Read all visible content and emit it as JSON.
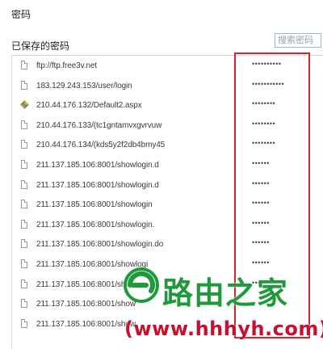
{
  "dialog": {
    "title": "密码",
    "section_label": "已保存的密码"
  },
  "search": {
    "placeholder": "搜索密码",
    "value": ""
  },
  "colors": {
    "highlight_box": "#d8232a",
    "watermark_green": "#1f9a3a",
    "watermark_red": "#c8102e"
  },
  "saved_passwords": [
    {
      "url": "ftp://ftp.free3v.net",
      "password": "••••••••••",
      "icon": "page-icon"
    },
    {
      "url": "183.129.243.153/user/login",
      "password": "•••••••••••",
      "icon": "page-icon"
    },
    {
      "url": "210.44.176.132/Default2.aspx",
      "password": "••••••••",
      "icon": "colorful-app-icon"
    },
    {
      "url": "210.44.176.133/(tc1gntamvxgvrvuw",
      "password": "••••••••",
      "icon": "page-icon"
    },
    {
      "url": "210.44.176.134/(kds5y2f2db4bmy45",
      "password": "••••••••",
      "icon": "page-icon"
    },
    {
      "url": "211.137.185.106:8001/showlogin.d",
      "password": "••••••",
      "icon": "page-icon"
    },
    {
      "url": "211.137.185.106:8001/showlogin.d",
      "password": "••••••",
      "icon": "page-icon"
    },
    {
      "url": "211.137.185.106:8001/showlogin",
      "password": "••••••",
      "icon": "page-icon"
    },
    {
      "url": "211.137.185.106:8001/showlogin.",
      "password": "••••••",
      "icon": "page-icon"
    },
    {
      "url": "211.137.185.106:8001/showlogin.do",
      "password": "••••••",
      "icon": "page-icon"
    },
    {
      "url": "211.137.185.106:8001/showlogi",
      "password": "••••••",
      "icon": "page-icon"
    },
    {
      "url": "211.137.185.106:8001/showl",
      "password": "••••••",
      "icon": "page-icon"
    },
    {
      "url": "211.137.185.106:8001/show",
      "password": "",
      "icon": "page-icon"
    },
    {
      "url": "211.137.185.106:8001/show",
      "password": "",
      "icon": "page-icon"
    }
  ],
  "watermark": {
    "name": "路由之家",
    "url": "(www.hhhyh.com)"
  }
}
